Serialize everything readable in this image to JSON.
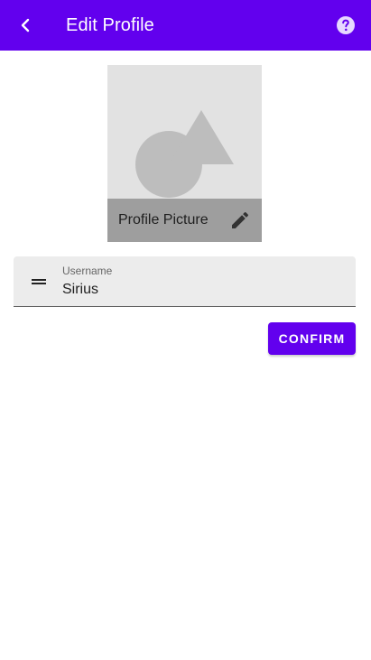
{
  "colors": {
    "primary": "#6200ee",
    "placeholder_bg": "#e2e2e2",
    "caption_bg": "#9e9e9e"
  },
  "appbar": {
    "title": "Edit Profile",
    "back_icon": "chevron-left-icon",
    "help_icon": "help-circle-icon"
  },
  "profile_picture": {
    "caption": "Profile Picture",
    "edit_icon": "pencil-icon",
    "placeholder_icon": "shapes-placeholder-icon"
  },
  "username_field": {
    "label": "Username",
    "value": "Sirius",
    "leading_icon": "drag-handle-icon"
  },
  "confirm_button": {
    "label": "CONFIRM"
  }
}
